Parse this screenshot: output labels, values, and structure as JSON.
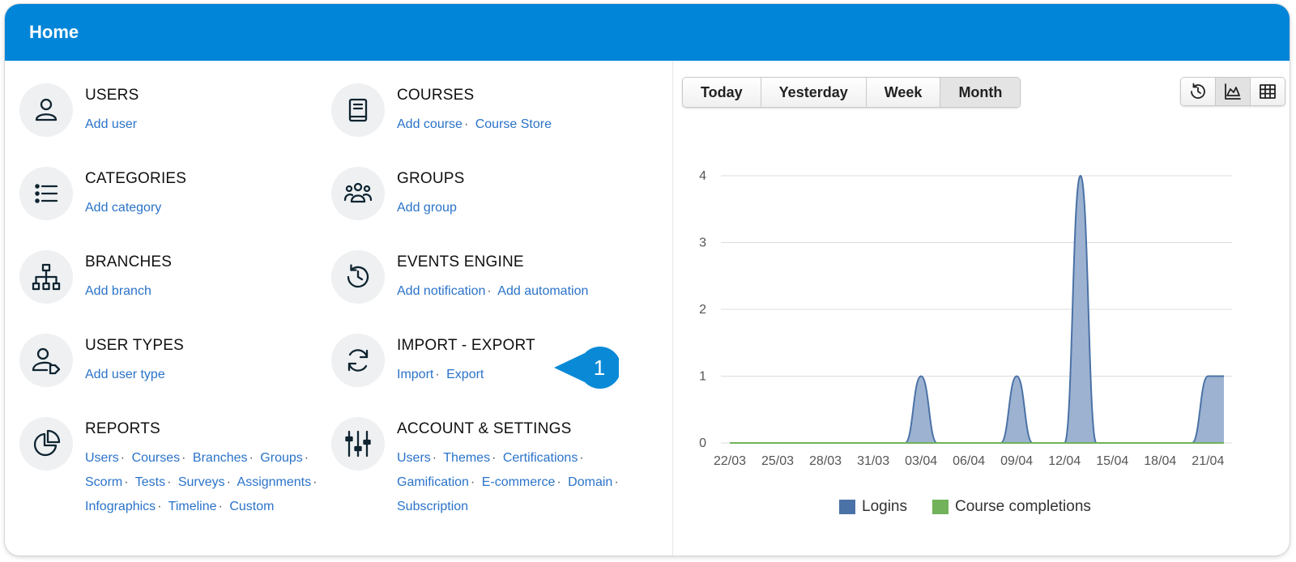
{
  "header": {
    "title": "Home"
  },
  "tiles": [
    {
      "title": "USERS",
      "icon": "user-icon",
      "links": [
        "Add user"
      ]
    },
    {
      "title": "COURSES",
      "icon": "book-icon",
      "links": [
        "Add course",
        "Course Store"
      ]
    },
    {
      "title": "CATEGORIES",
      "icon": "list-icon",
      "links": [
        "Add category"
      ]
    },
    {
      "title": "GROUPS",
      "icon": "group-icon",
      "links": [
        "Add group"
      ]
    },
    {
      "title": "BRANCHES",
      "icon": "sitemap-icon",
      "links": [
        "Add branch"
      ]
    },
    {
      "title": "EVENTS ENGINE",
      "icon": "history-icon",
      "links": [
        "Add notification",
        "Add automation"
      ]
    },
    {
      "title": "USER TYPES",
      "icon": "user-tag-icon",
      "links": [
        "Add user type"
      ]
    },
    {
      "title": "IMPORT - EXPORT",
      "icon": "sync-icon",
      "links": [
        "Import",
        "Export"
      ]
    },
    {
      "title": "REPORTS",
      "icon": "pie-chart-icon",
      "links": [
        "Users",
        "Courses",
        "Branches",
        "Groups",
        "Scorm",
        "Tests",
        "Surveys",
        "Assignments",
        "Infographics",
        "Timeline",
        "Custom"
      ]
    },
    {
      "title": "ACCOUNT & SETTINGS",
      "icon": "sliders-icon",
      "links": [
        "Users",
        "Themes",
        "Certifications",
        "Gamification",
        "E-commerce",
        "Domain",
        "Subscription"
      ]
    }
  ],
  "callout": {
    "number": "1",
    "color": "#0a8ad6"
  },
  "period_buttons": [
    "Today",
    "Yesterday",
    "Week",
    "Month"
  ],
  "active_period": "Month",
  "view_buttons": [
    {
      "icon": "history-icon",
      "active": false
    },
    {
      "icon": "area-chart-icon",
      "active": true
    },
    {
      "icon": "table-icon",
      "active": false
    }
  ],
  "chart_data": {
    "type": "area",
    "x": [
      "22/03",
      "23/03",
      "24/03",
      "25/03",
      "26/03",
      "27/03",
      "28/03",
      "29/03",
      "30/03",
      "31/03",
      "01/04",
      "02/04",
      "03/04",
      "04/04",
      "05/04",
      "06/04",
      "07/04",
      "08/04",
      "09/04",
      "10/04",
      "11/04",
      "12/04",
      "13/04",
      "14/04",
      "15/04",
      "16/04",
      "17/04",
      "18/04",
      "19/04",
      "20/04",
      "21/04",
      "22/04"
    ],
    "x_tick_labels": [
      "22/03",
      "25/03",
      "28/03",
      "31/03",
      "03/04",
      "06/04",
      "09/04",
      "12/04",
      "15/04",
      "18/04",
      "21/04"
    ],
    "y_ticks": [
      "0",
      "1",
      "2",
      "3",
      "4"
    ],
    "ylim": [
      0,
      4
    ],
    "grid": true,
    "legend_position": "bottom",
    "series": [
      {
        "name": "Logins",
        "color": "#4a72a6",
        "fill": "#9db2d1",
        "values": [
          0,
          0,
          0,
          0,
          0,
          0,
          0,
          0,
          0,
          0,
          0,
          0,
          1,
          0,
          0,
          0,
          0,
          0,
          1,
          0,
          0,
          0,
          4,
          0,
          0,
          0,
          0,
          0,
          0,
          0,
          1,
          1
        ]
      },
      {
        "name": "Course completions",
        "color": "#71b25a",
        "fill": "#71b25a",
        "values": [
          0,
          0,
          0,
          0,
          0,
          0,
          0,
          0,
          0,
          0,
          0,
          0,
          0,
          0,
          0,
          0,
          0,
          0,
          0,
          0,
          0,
          0,
          0,
          0,
          0,
          0,
          0,
          0,
          0,
          0,
          0,
          0
        ]
      }
    ]
  }
}
